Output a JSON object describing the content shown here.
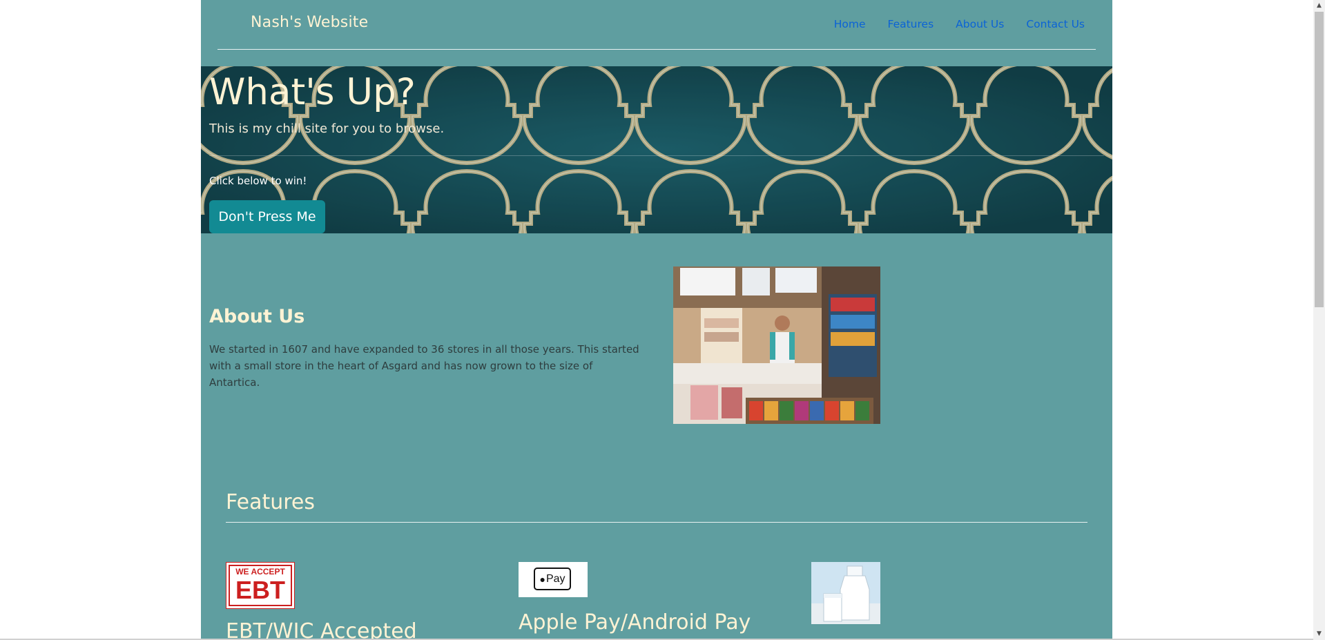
{
  "header": {
    "brand": "Nash's Website",
    "nav": [
      "Home",
      "Features",
      "About Us",
      "Contact Us"
    ]
  },
  "hero": {
    "title": "What's Up?",
    "subtitle": "This is my chill site for you to browse.",
    "note": "Click below to win!",
    "button_label": "Don't Press Me"
  },
  "about": {
    "title": "About Us",
    "text": "We started in 1607 and have expanded to 36 stores in all those years. This started with a small store in the heart of Asgard and has now grown to the size of Antartica."
  },
  "features": {
    "title": "Features",
    "items": [
      {
        "title": "EBT/WIC Accepted",
        "image_icon": "ebt-logo",
        "image_text_top": "WE ACCEPT",
        "image_text_main": "EBT"
      },
      {
        "title": "Apple Pay/Android Pay",
        "image_icon": "apple-pay-logo",
        "image_text": "Pay"
      },
      {
        "title": "",
        "image_icon": "milk-photo"
      }
    ]
  },
  "colors": {
    "page_bg": "#5f9ea0",
    "accent_text": "#fff3d4",
    "link": "#0b63d6",
    "button": "#128a93",
    "hero_bg": "#174f58",
    "pattern_gold": "#d7c596"
  }
}
